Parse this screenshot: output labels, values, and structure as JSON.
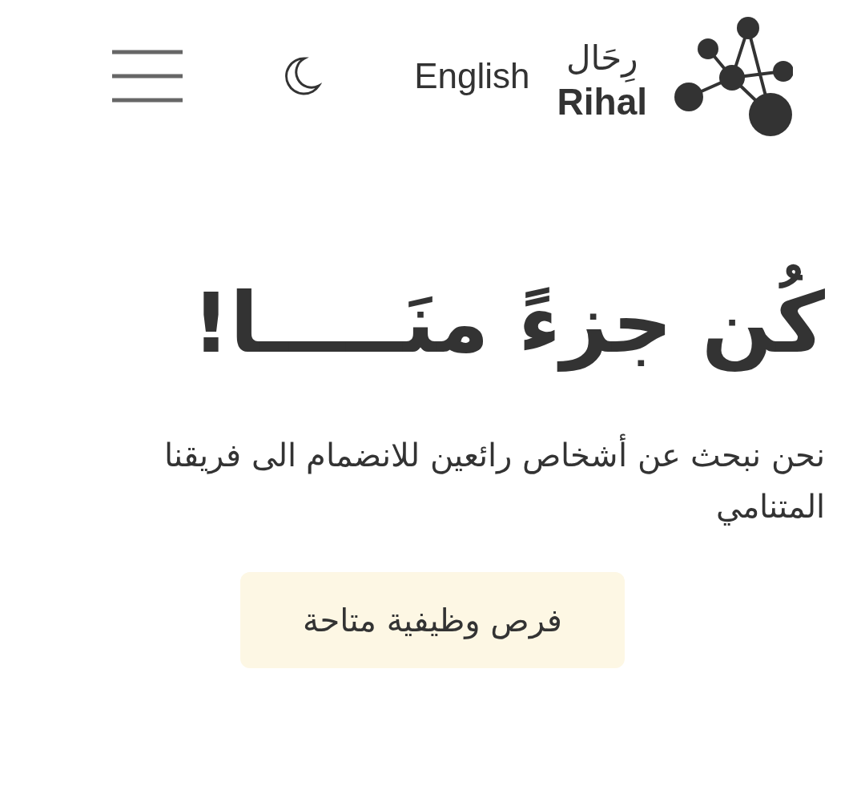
{
  "header": {
    "logo": {
      "arabic": "رِحَال",
      "latin": "Rihal"
    },
    "language_link": "English"
  },
  "hero": {
    "title": "كُن جزءً منَـــــا!",
    "description": "نحن نبحث عن أشخاص رائعين للانضمام الى فريقنا المتنامي",
    "button": "فرص وظيفية متاحة"
  }
}
